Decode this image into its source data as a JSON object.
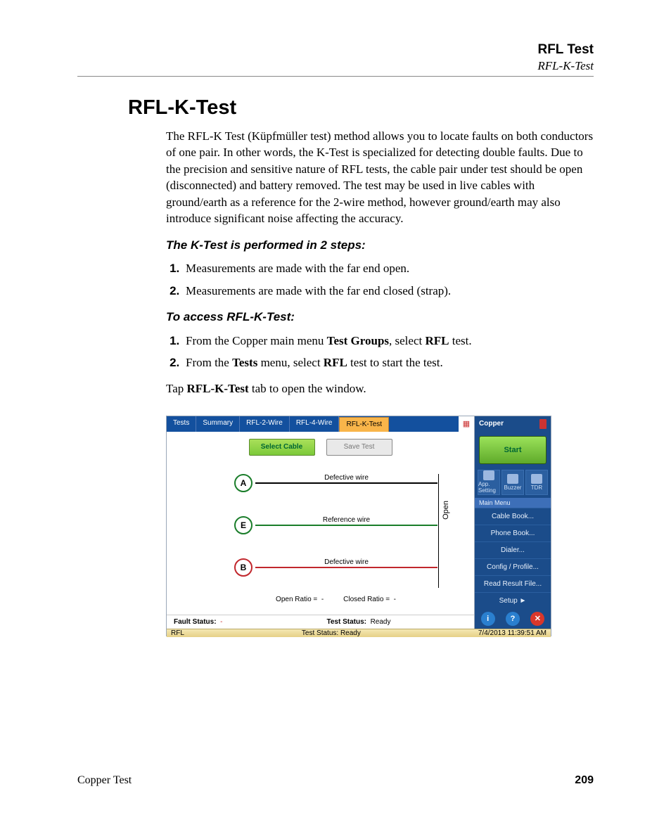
{
  "header": {
    "chapter": "RFL Test",
    "section": "RFL-K-Test"
  },
  "title": "RFL-K-Test",
  "intro": "The RFL-K Test (Küpfmüller  test) method allows you to locate faults on both conductors of one pair. In other words, the K-Test is specialized for detecting double faults. Due to the precision and sensitive nature of RFL tests, the cable pair under test should be open (disconnected) and battery removed. The test may be used in live cables with ground/earth as a reference for the 2-wire method, however ground/earth may also introduce significant noise affecting the accuracy.",
  "subhead1": "The K-Test is performed in 2 steps:",
  "steps1": [
    "Measurements are made with the far end open.",
    "Measurements are made with the far end closed (strap)."
  ],
  "subhead2": "To access RFL-K-Test:",
  "steps2": [
    {
      "pre": "From the Copper main menu ",
      "b1": "Test Groups",
      "mid": ", select ",
      "b2": "RFL",
      "post": " test."
    },
    {
      "pre": "From the ",
      "b1": "Tests",
      "mid": " menu, select ",
      "b2": "RFL",
      "post": " test to start the test."
    }
  ],
  "tapline": {
    "pre": "Tap ",
    "b": "RFL-K-Test",
    "post": " tab to open the window."
  },
  "shot": {
    "tabs": [
      "Tests",
      "Summary",
      "RFL-2-Wire",
      "RFL-4-Wire",
      "RFL-K-Test"
    ],
    "activeTab": 4,
    "btnSelectCable": "Select Cable",
    "btnSaveTest": "Save Test",
    "wires": {
      "A": {
        "letter": "A",
        "label": "Defective wire"
      },
      "E": {
        "letter": "E",
        "label": "Reference wire"
      },
      "B": {
        "letter": "B",
        "label": "Defective wire"
      }
    },
    "openText": "Open",
    "openRatio": {
      "label": "Open Ratio  =",
      "value": "-"
    },
    "closedRatio": {
      "label": "Closed Ratio  =",
      "value": "-"
    },
    "faultStatusLabel": "Fault Status:",
    "faultStatusValue": "-",
    "testStatusLabel": "Test Status:",
    "testStatusValue": "Ready",
    "side": {
      "title": "Copper",
      "start": "Start",
      "icons": [
        {
          "label": "App. Setting"
        },
        {
          "label": "Buzzer"
        },
        {
          "label": "TDR"
        }
      ],
      "mainMenuLabel": "Main Menu",
      "menu": [
        "Cable Book...",
        "Phone Book...",
        "Dialer...",
        "Config / Profile...",
        "Read Result File...",
        "Setup      ►"
      ]
    },
    "footer": {
      "left": "RFL",
      "mid": "Test Status: Ready",
      "right": "7/4/2013 11:39:51 AM"
    }
  },
  "pagefoot": {
    "left": "Copper Test",
    "right": "209"
  }
}
